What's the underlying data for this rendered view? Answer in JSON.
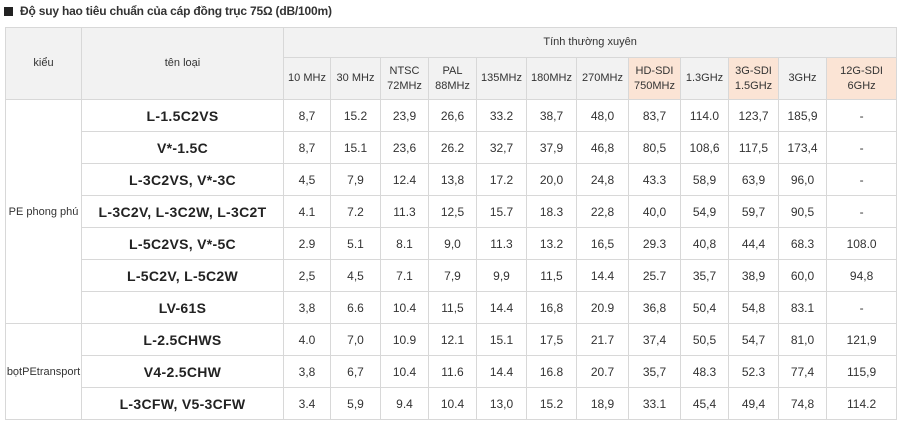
{
  "title": "Độ suy hao tiêu chuẩn của cáp đồng trục 75Ω (dB/100m)",
  "header": {
    "type_label": "kiểu",
    "name_label": "tên loại",
    "group_label": "Tính thường xuyên",
    "freqs": [
      {
        "line1": "10 MHz",
        "line2": "",
        "highlight": false
      },
      {
        "line1": "30 MHz",
        "line2": "",
        "highlight": false
      },
      {
        "line1": "NTSC",
        "line2": "72MHz",
        "highlight": false
      },
      {
        "line1": "PAL",
        "line2": "88MHz",
        "highlight": false
      },
      {
        "line1": "135MHz",
        "line2": "",
        "highlight": false
      },
      {
        "line1": "180MHz",
        "line2": "",
        "highlight": false
      },
      {
        "line1": "270MHz",
        "line2": "",
        "highlight": false
      },
      {
        "line1": "HD-SDI",
        "line2": "750MHz",
        "highlight": true
      },
      {
        "line1": "1.3GHz",
        "line2": "",
        "highlight": false
      },
      {
        "line1": "3G-SDI",
        "line2": "1.5GHz",
        "highlight": true
      },
      {
        "line1": "3GHz",
        "line2": "",
        "highlight": false
      },
      {
        "line1": "12G-SDI",
        "line2": "6GHz",
        "highlight": true
      }
    ]
  },
  "groups": [
    {
      "name": "PE phong phú",
      "rows": [
        {
          "model": "L-1.5C2VS",
          "values": [
            "8,7",
            "15.2",
            "23,9",
            "26,6",
            "33.2",
            "38,7",
            "48,0",
            "83,7",
            "114.0",
            "123,7",
            "185,9",
            "-"
          ]
        },
        {
          "model": "V*-1.5C",
          "values": [
            "8,7",
            "15.1",
            "23,6",
            "26.2",
            "32,7",
            "37,9",
            "46,8",
            "80,5",
            "108,6",
            "117,5",
            "173,4",
            "-"
          ]
        },
        {
          "model": "L-3C2VS, V*-3C",
          "values": [
            "4,5",
            "7,9",
            "12.4",
            "13,8",
            "17.2",
            "20,0",
            "24,8",
            "43.3",
            "58,9",
            "63,9",
            "96,0",
            "-"
          ]
        },
        {
          "model": "L-3C2V, L-3C2W, L-3C2T",
          "values": [
            "4.1",
            "7.2",
            "11.3",
            "12,5",
            "15.7",
            "18.3",
            "22,8",
            "40,0",
            "54,9",
            "59,7",
            "90,5",
            "-"
          ]
        },
        {
          "model": "L-5C2VS, V*-5C",
          "values": [
            "2.9",
            "5.1",
            "8.1",
            "9,0",
            "11.3",
            "13.2",
            "16,5",
            "29.3",
            "40,8",
            "44,4",
            "68.3",
            "108.0"
          ]
        },
        {
          "model": "L-5C2V, L-5C2W",
          "values": [
            "2,5",
            "4,5",
            "7.1",
            "7,9",
            "9,9",
            "11,5",
            "14.4",
            "25.7",
            "35,7",
            "38,9",
            "60,0",
            "94,8"
          ]
        },
        {
          "model": "LV-61S",
          "values": [
            "3,8",
            "6.6",
            "10.4",
            "11,5",
            "14.4",
            "16,8",
            "20.9",
            "36,8",
            "50,4",
            "54,8",
            "83.1",
            "-"
          ]
        }
      ]
    },
    {
      "name": "bọtPEtransport",
      "rows": [
        {
          "model": "L-2.5CHWS",
          "values": [
            "4.0",
            "7,0",
            "10.9",
            "12.1",
            "15.1",
            "17,5",
            "21.7",
            "37,4",
            "50,5",
            "54,7",
            "81,0",
            "121,9"
          ]
        },
        {
          "model": "V4-2.5CHW",
          "values": [
            "3,8",
            "6,7",
            "10.4",
            "11.6",
            "14.4",
            "16.8",
            "20.7",
            "35,7",
            "48.3",
            "52.3",
            "77,4",
            "115,9"
          ]
        },
        {
          "model": "L-3CFW, V5-3CFW",
          "values": [
            "3.4",
            "5,9",
            "9.4",
            "10.4",
            "13,0",
            "15.2",
            "18,9",
            "33.1",
            "45,4",
            "49,4",
            "74,8",
            "114.2"
          ]
        }
      ]
    }
  ]
}
